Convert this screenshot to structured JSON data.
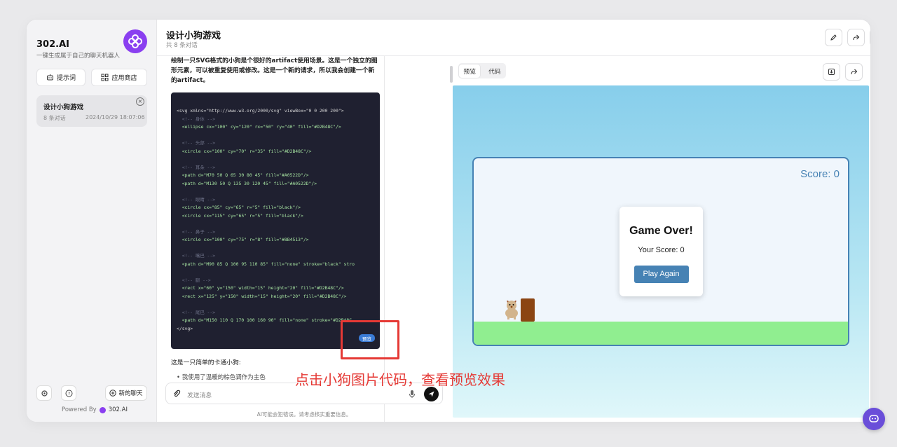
{
  "sidebar": {
    "brand_title": "302.AI",
    "brand_subtitle": "一键生成属于自己的聊天机器人",
    "prompt_button": "提示词",
    "store_button": "应用商店",
    "conversation": {
      "title": "设计小狗游戏",
      "count": "8 条对话",
      "time": "2024/10/29 18:07:06"
    },
    "new_chat": "新的聊天",
    "powered_label": "Powered By",
    "powered_brand": "302.AI"
  },
  "header": {
    "title": "设计小狗游戏",
    "subtitle": "共 8 条对话"
  },
  "chat": {
    "message_text": "绘制一只SVG格式的小狗是个很好的artifact使用场景。这是一个独立的图形元素，可以被重复使用或修改。这是一个新的请求，所以我会创建一个新的artifact。",
    "code_lines": [
      {
        "cls": "tg",
        "text": "<svg xmlns=\"http://www.w3.org/2000/svg\" viewBox=\"0 0 200 200\">"
      },
      {
        "cls": "cm",
        "text": "  <!-- 身体 -->"
      },
      {
        "cls": "at",
        "text": "  <ellipse cx=\"100\" cy=\"120\" rx=\"50\" ry=\"40\" fill=\"#D2B48C\"/>"
      },
      {
        "cls": "tg",
        "text": ""
      },
      {
        "cls": "cm",
        "text": "  <!-- 头部 -->"
      },
      {
        "cls": "at",
        "text": "  <circle cx=\"100\" cy=\"70\" r=\"35\" fill=\"#D2B48C\"/>"
      },
      {
        "cls": "tg",
        "text": ""
      },
      {
        "cls": "cm",
        "text": "  <!-- 耳朵 -->"
      },
      {
        "cls": "at",
        "text": "  <path d=\"M70 50 Q 65 30 80 45\" fill=\"#A0522D\"/>"
      },
      {
        "cls": "at",
        "text": "  <path d=\"M130 50 Q 135 30 120 45\" fill=\"#A0522D\"/>"
      },
      {
        "cls": "tg",
        "text": ""
      },
      {
        "cls": "cm",
        "text": "  <!-- 眼睛 -->"
      },
      {
        "cls": "at",
        "text": "  <circle cx=\"85\" cy=\"65\" r=\"5\" fill=\"black\"/>"
      },
      {
        "cls": "at",
        "text": "  <circle cx=\"115\" cy=\"65\" r=\"5\" fill=\"black\"/>"
      },
      {
        "cls": "tg",
        "text": ""
      },
      {
        "cls": "cm",
        "text": "  <!-- 鼻子 -->"
      },
      {
        "cls": "at",
        "text": "  <circle cx=\"100\" cy=\"75\" r=\"8\" fill=\"#8B4513\"/>"
      },
      {
        "cls": "tg",
        "text": ""
      },
      {
        "cls": "cm",
        "text": "  <!-- 嘴巴 -->"
      },
      {
        "cls": "at",
        "text": "  <path d=\"M90 85 Q 100 95 110 85\" fill=\"none\" stroke=\"black\" stro"
      },
      {
        "cls": "tg",
        "text": ""
      },
      {
        "cls": "cm",
        "text": "  <!-- 腿 -->"
      },
      {
        "cls": "at",
        "text": "  <rect x=\"60\" y=\"150\" width=\"15\" height=\"20\" fill=\"#D2B48C\"/>"
      },
      {
        "cls": "at",
        "text": "  <rect x=\"125\" y=\"150\" width=\"15\" height=\"20\" fill=\"#D2B48C\"/>"
      },
      {
        "cls": "tg",
        "text": ""
      },
      {
        "cls": "cm",
        "text": "  <!-- 尾巴 -->"
      },
      {
        "cls": "at",
        "text": "  <path d=\"M150 110 Q 170 100 160 90\" fill=\"none\" stroke=\"#D2B48C"
      },
      {
        "cls": "tg",
        "text": "</svg>"
      }
    ],
    "preview_tag": "预览",
    "after_text": "这是一只简单的卡通小狗:",
    "bullet_text": "• 我使用了温暖的棕色调作为主色",
    "input_placeholder": "发送消息",
    "disclaimer": "AI可能会犯错误。请考虑核实重要信息。"
  },
  "panel": {
    "tab_preview": "预览",
    "tab_code": "代码",
    "game": {
      "score_label": "Score: 0",
      "over_title": "Game Over!",
      "over_score": "Your Score: 0",
      "play_again": "Play Again"
    }
  },
  "annotation": "点击小狗图片代码，查看预览效果",
  "colors": {
    "brand": "#8a3ff0",
    "accent": "#4682b4",
    "ground": "#90ee90",
    "annotation": "#e53935"
  }
}
